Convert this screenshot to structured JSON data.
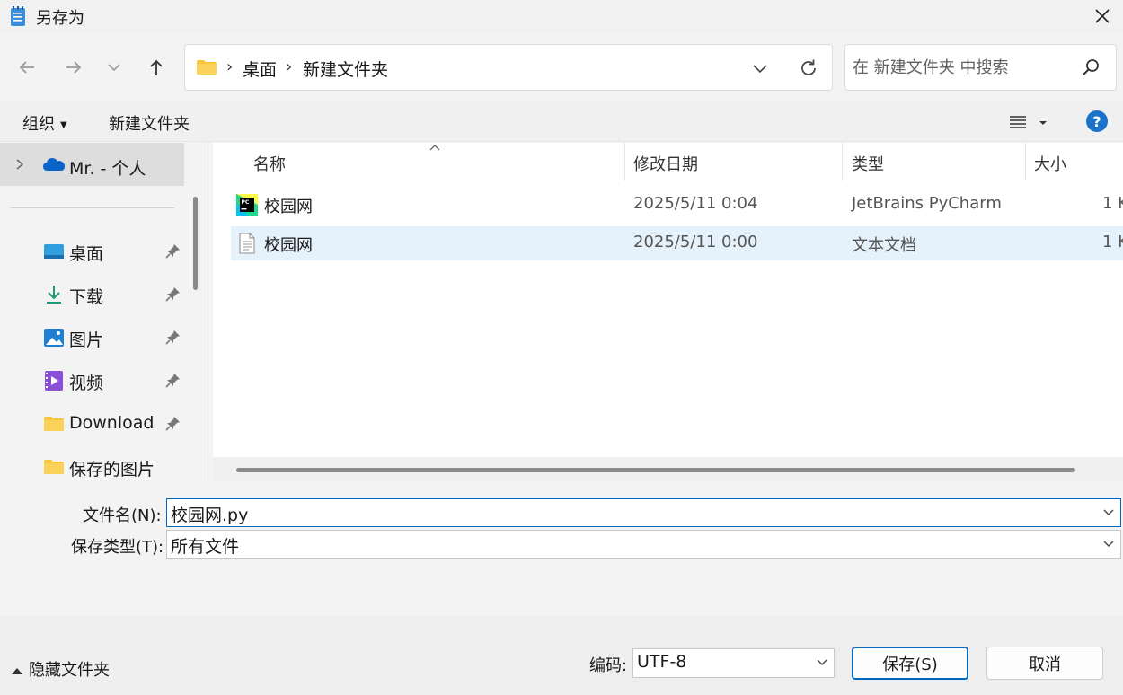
{
  "window": {
    "title": "另存为",
    "icon": "notepad-icon"
  },
  "nav": {
    "back_icon": "arrow-left-icon",
    "forward_icon": "arrow-right-icon",
    "recent_icon": "chevron-down-icon",
    "up_icon": "arrow-up-icon"
  },
  "address": {
    "crumbs": [
      "桌面",
      "新建文件夹"
    ],
    "separator": "›"
  },
  "search": {
    "placeholder": "在 新建文件夹 中搜索"
  },
  "toolbar": {
    "organize_label": "组织",
    "new_folder_label": "新建文件夹",
    "help_label": "?"
  },
  "sidebar": {
    "onedrive_label": "Mr. - 个人",
    "items": [
      {
        "label": "桌面",
        "icon": "desktop-icon",
        "pinned": true
      },
      {
        "label": "下载",
        "icon": "download-icon",
        "pinned": true
      },
      {
        "label": "图片",
        "icon": "pictures-icon",
        "pinned": true
      },
      {
        "label": "视频",
        "icon": "videos-icon",
        "pinned": true
      },
      {
        "label": "Download",
        "icon": "folder-icon",
        "pinned": true
      },
      {
        "label": "保存的图片",
        "icon": "folder-icon",
        "pinned": false
      }
    ]
  },
  "columns": {
    "name": "名称",
    "modified": "修改日期",
    "type": "类型",
    "size": "大小"
  },
  "files": [
    {
      "name": "校园网",
      "modified": "2025/5/11 0:04",
      "type": "JetBrains PyCharm",
      "size": "1 K",
      "icon": "pycharm-file-icon",
      "selected": false
    },
    {
      "name": "校园网",
      "modified": "2025/5/11 0:00",
      "type": "文本文档",
      "size": "1 K",
      "icon": "text-file-icon",
      "selected": true
    }
  ],
  "form": {
    "filename_label": "文件名(N):",
    "filename_value": "校园网.py",
    "filetype_label": "保存类型(T):",
    "filetype_value": "所有文件"
  },
  "footer": {
    "hide_folders_label": "隐藏文件夹",
    "encoding_label": "编码:",
    "encoding_value": "UTF-8",
    "save_label": "保存(S)",
    "cancel_label": "取消"
  },
  "colors": {
    "accent": "#0067c0",
    "selection": "#e5f1fb",
    "folder": "#f8c637"
  }
}
